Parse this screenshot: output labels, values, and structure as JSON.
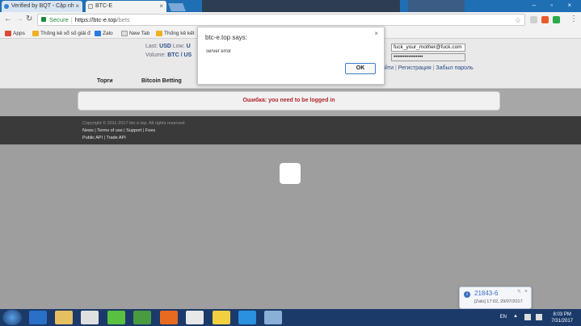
{
  "browser": {
    "tabs": [
      {
        "title": "Verified by BQT - Cập nh",
        "close": "×"
      },
      {
        "title": "BTC-E",
        "close": "×"
      }
    ],
    "url": {
      "secure_label": "Secure",
      "host": "https://btc-e.top",
      "path": "/bets"
    },
    "bookmarks": [
      "Apps",
      "Thống kê xổ số giải đ",
      "Zalo",
      "New Tab",
      "Thống kê kết"
    ]
  },
  "header": {
    "last_label": "Last:",
    "last_currency": "USD",
    "low_label": "Low:",
    "low_value": "U",
    "volume_label": "Volume:",
    "volume_value": "BTC / US",
    "nav": [
      "Торги",
      "Bitcoin Betting"
    ],
    "login_email": "fuck_your_mother@fuck.com",
    "login_password": "••••••••••••••••",
    "links": {
      "login_tail": "йти",
      "register": "Регистрация",
      "forgot": "Забыл пароль"
    }
  },
  "error": {
    "message": "Ошибка: you need to be logged in"
  },
  "footer": {
    "copyright": "Copyright © 2011-2017 btc-e.top. All rights reserved.",
    "links_row1": [
      "News",
      "Terms of use",
      "Support",
      "Fees"
    ],
    "links_row2": [
      "Public API",
      "Trade API"
    ]
  },
  "dialog": {
    "title": "btc-e.top says:",
    "message": "server error",
    "ok_label": "OK",
    "close": "×"
  },
  "notification": {
    "number": "21843-6",
    "detail": "[Zalo] 17:02, 29/07/2017",
    "close": "×",
    "icon": "i"
  },
  "tray": {
    "lang": "EN",
    "time": "8:03 PM",
    "date": "7/31/2017"
  }
}
